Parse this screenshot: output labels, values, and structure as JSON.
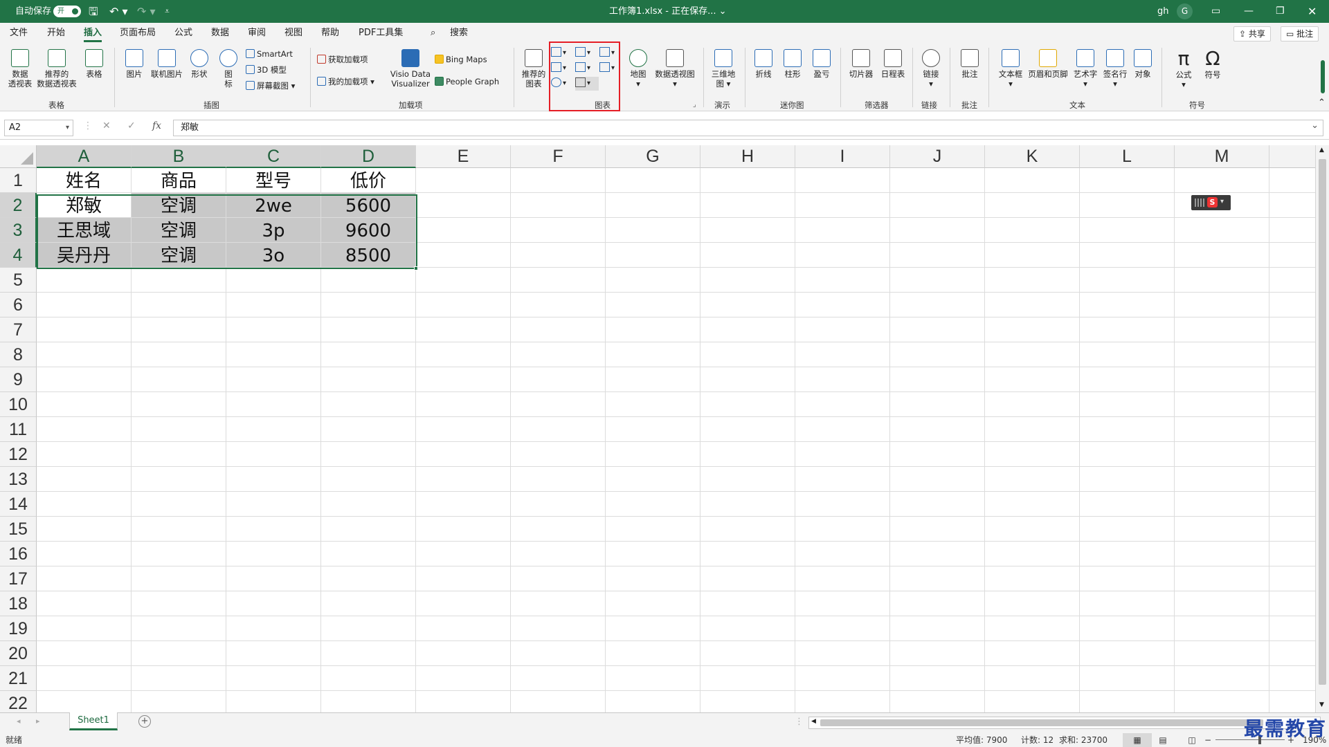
{
  "titlebar": {
    "autosave_label": "自动保存",
    "autosave_state": "开",
    "title": "工作簿1.xlsx - 正在保存... ⌄",
    "user": "gh",
    "avatar_letter": "G"
  },
  "menu": {
    "tabs": [
      "文件",
      "开始",
      "插入",
      "页面布局",
      "公式",
      "数据",
      "审阅",
      "视图",
      "帮助",
      "PDF工具集"
    ],
    "active_tab": "插入",
    "search_label": "搜索",
    "share_label": "共享",
    "comment_label": "批注"
  },
  "ribbon": {
    "groups": {
      "tables": "表格",
      "illustrations": "插图",
      "addins": "加载项",
      "charts": "图表",
      "tours": "演示",
      "sparklines": "迷你图",
      "filters": "筛选器",
      "links": "链接",
      "comments": "批注",
      "text": "文本",
      "symbols": "符号"
    },
    "buttons": {
      "pivot_l1": "数据",
      "pivot_l2": "透视表",
      "rec_pivot_l1": "推荐的",
      "rec_pivot_l2": "数据透视表",
      "table": "表格",
      "picture": "图片",
      "online_picture": "联机图片",
      "shapes": "形状",
      "icons_l1": "图",
      "icons_l2": "标",
      "smartart": "SmartArt",
      "model3d": "3D 模型",
      "screenshot": "屏幕截图",
      "get_addins": "获取加载项",
      "my_addins": "我的加载项",
      "visio_l1": "Visio Data",
      "visio_l2": "Visualizer",
      "bing_maps": "Bing Maps",
      "people_graph": "People Graph",
      "rec_charts_l1": "推荐的",
      "rec_charts_l2": "图表",
      "maps": "地图",
      "pivot_chart": "数据透视图",
      "map3d_l1": "三维地",
      "map3d_l2": "图",
      "line": "折线",
      "column": "柱形",
      "winloss": "盈亏",
      "slicer": "切片器",
      "timeline": "日程表",
      "link": "链接",
      "comment": "批注",
      "textbox": "文本框",
      "header_footer": "页眉和页脚",
      "wordart": "艺术字",
      "signature": "签名行",
      "object": "对象",
      "equation": "公式",
      "symbol": "符号"
    }
  },
  "formula_bar": {
    "name_box": "A2",
    "cancel": "✕",
    "enter": "✓",
    "fx": "fx",
    "content": "郑敏"
  },
  "sheet": {
    "columns": [
      "A",
      "B",
      "C",
      "D",
      "E",
      "F",
      "G",
      "H",
      "I",
      "J",
      "K",
      "L",
      "M"
    ],
    "rows": [
      "1",
      "2",
      "3",
      "4",
      "5",
      "6",
      "7",
      "8",
      "9",
      "10",
      "11",
      "12",
      "13",
      "14",
      "15",
      "16",
      "17",
      "18",
      "19",
      "20",
      "21",
      "22"
    ],
    "cells": [
      [
        "姓名",
        "商品",
        "型号",
        "低价"
      ],
      [
        "郑敏",
        "空调",
        "2we",
        "5600"
      ],
      [
        "王思域",
        "空调",
        "3p",
        "9600"
      ],
      [
        "吴丹丹",
        "空调",
        "3o",
        "8500"
      ]
    ]
  },
  "sheet_tabs": {
    "active": "Sheet1",
    "add": "+"
  },
  "status": {
    "ready": "就绪",
    "average": "平均值: 7900",
    "count": "计数: 12",
    "sum": "求和: 23700",
    "zoom": "190%"
  },
  "watermark": "最需教育",
  "colors": {
    "excel_green": "#217346",
    "highlight_red": "#e51d25",
    "selection_fill": "#c8c8c8"
  }
}
